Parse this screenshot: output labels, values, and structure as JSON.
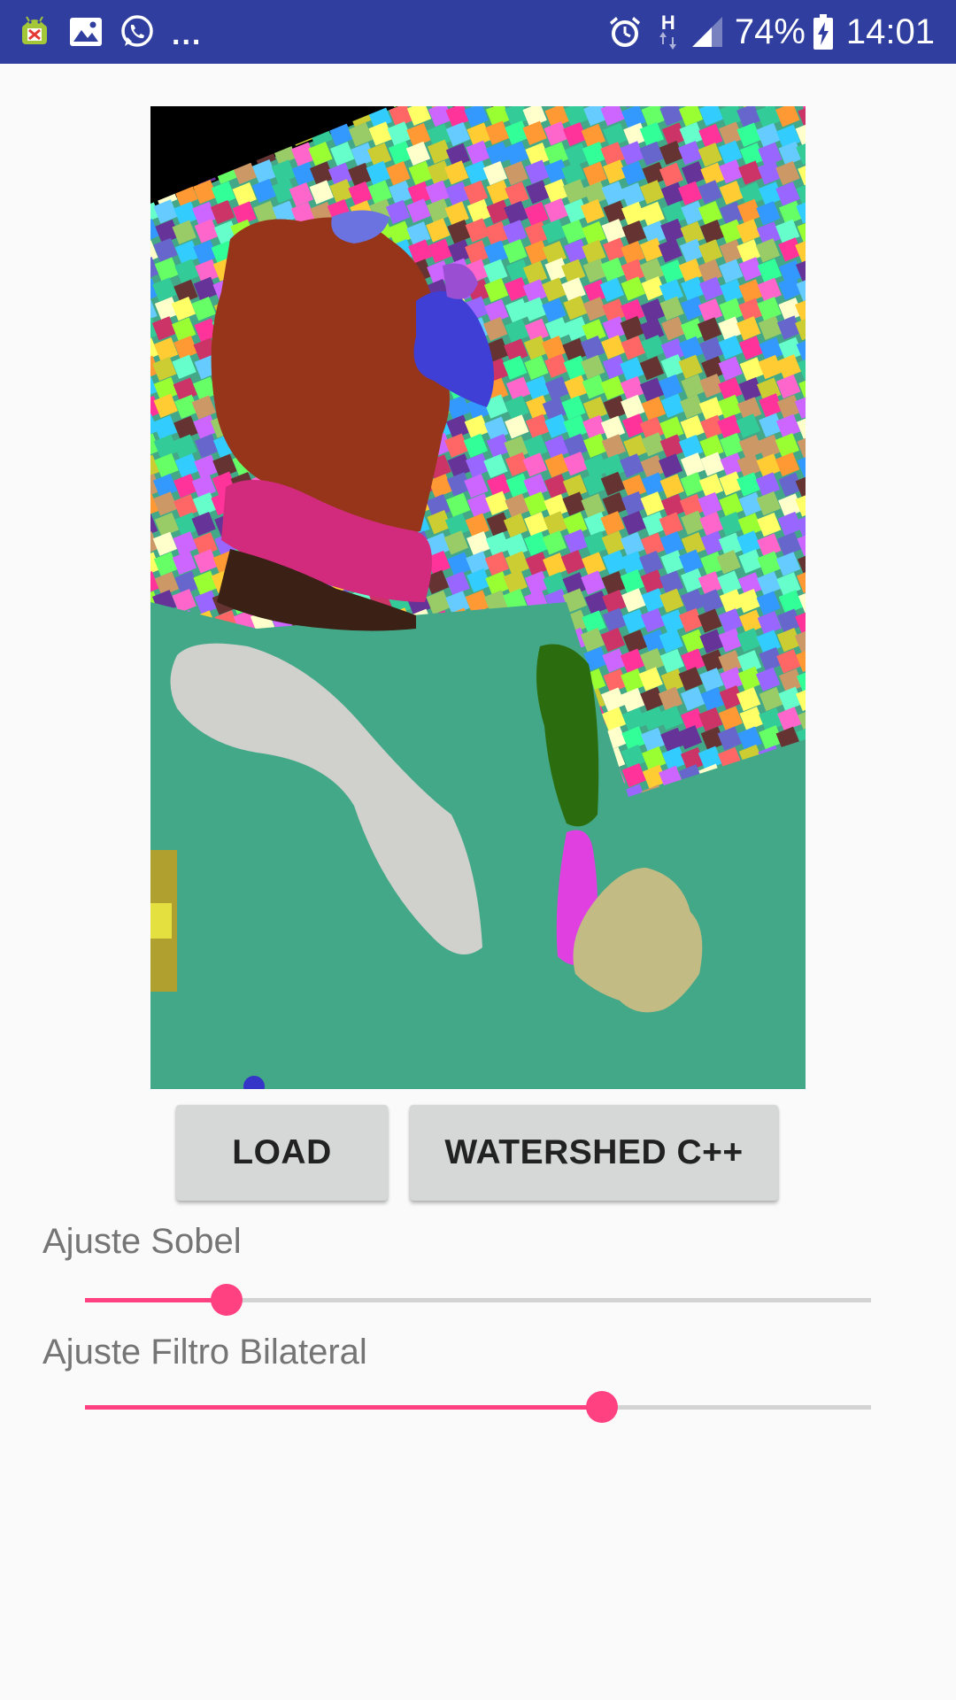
{
  "status_bar": {
    "notification_icons": [
      "android-debug-icon",
      "image-icon",
      "whatsapp-icon"
    ],
    "overflow_dots": "...",
    "system_icons": [
      "alarm-icon",
      "network-h-icon",
      "signal-icon",
      "battery-charging-icon"
    ],
    "network_type": "H",
    "battery_percent": "74%",
    "time": "14:01"
  },
  "image": {
    "description_icon": "watershed-segmentation-result"
  },
  "buttons": {
    "load_label": "LOAD",
    "watershed_label": "WATERSHED C++"
  },
  "sliders": {
    "sobel": {
      "label": "Ajuste Sobel",
      "value_fraction": 0.18
    },
    "bilateral": {
      "label": "Ajuste Filtro Bilateral",
      "value_fraction": 0.658
    }
  },
  "colors": {
    "status_bar": "#303f9f",
    "accent": "#ff4081",
    "button_bg": "#d6d7d7",
    "background": "#fafafa",
    "segment_green": "#43a887",
    "segment_brown": "#97351a",
    "segment_pink": "#d22b7d",
    "segment_light_gray": "#d0d0cc"
  }
}
